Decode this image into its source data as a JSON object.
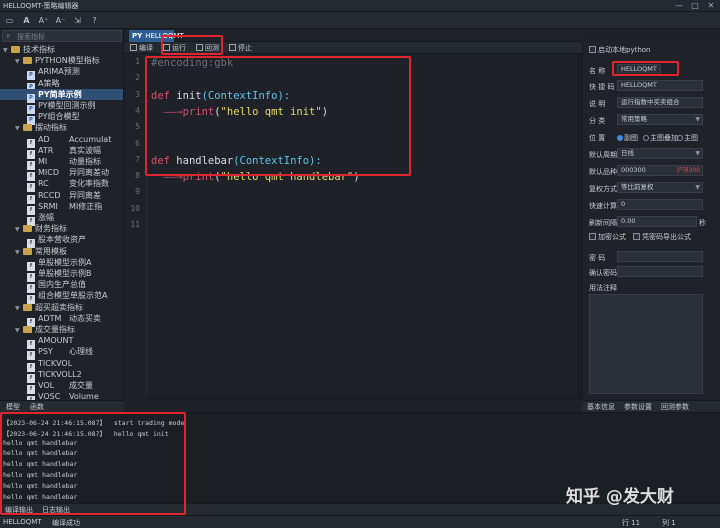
{
  "window": {
    "title": "HELLOQMT-策略编辑器",
    "min": "—",
    "max": "□",
    "close": "✕"
  },
  "toolbar": {
    "icons": [
      "new-icon",
      "open-icon",
      "font-bigger-icon",
      "font-smaller-icon",
      "save-icon",
      "help-icon"
    ],
    "glyphs": [
      "A",
      "A",
      "A",
      "A",
      "⇲",
      "?"
    ]
  },
  "search": {
    "placeholder": "搜索指标",
    "icon": "⌕"
  },
  "tree": [
    {
      "label": "技术指标",
      "level": 0,
      "type": "folder",
      "expanded": true
    },
    {
      "label": "PYTHON模型指标",
      "level": 1,
      "type": "folder",
      "expanded": true
    },
    {
      "label": "ARIMA预测",
      "level": 2,
      "type": "py"
    },
    {
      "label": "A策略",
      "level": 2,
      "type": "py"
    },
    {
      "label": "PY简单示例",
      "level": 2,
      "type": "py",
      "selected": true
    },
    {
      "label": "PY模型回测示例",
      "level": 2,
      "type": "py"
    },
    {
      "label": "PY组合模型",
      "level": 2,
      "type": "py"
    },
    {
      "label": "摆动指标",
      "level": 1,
      "type": "folder",
      "expanded": true
    },
    {
      "label": "AD",
      "sub": "Accumulat",
      "level": 2,
      "type": "file"
    },
    {
      "label": "ATR",
      "sub": "真实波幅",
      "level": 2,
      "type": "file"
    },
    {
      "label": "MI",
      "sub": "动量指标",
      "level": 2,
      "type": "file"
    },
    {
      "label": "MICD",
      "sub": "异同离差动",
      "level": 2,
      "type": "file"
    },
    {
      "label": "RC",
      "sub": "变化率指数",
      "level": 2,
      "type": "file"
    },
    {
      "label": "RCCD",
      "sub": "异同离差",
      "level": 2,
      "type": "file"
    },
    {
      "label": "SRMI",
      "sub": "MI修正指",
      "level": 2,
      "type": "file"
    },
    {
      "label": "涨幅",
      "level": 2,
      "type": "file"
    },
    {
      "label": "财务指标",
      "level": 1,
      "type": "folder",
      "expanded": true
    },
    {
      "label": "股本营收资产",
      "level": 2,
      "type": "file"
    },
    {
      "label": "常用模板",
      "level": 1,
      "type": "folder",
      "expanded": true
    },
    {
      "label": "单股模型示例A",
      "level": 2,
      "type": "file"
    },
    {
      "label": "单股模型示例B",
      "level": 2,
      "type": "file"
    },
    {
      "label": "国内生产总值",
      "level": 2,
      "type": "file"
    },
    {
      "label": "组合模型单股示范A",
      "level": 2,
      "type": "file"
    },
    {
      "label": "超买超卖指标",
      "level": 1,
      "type": "folder",
      "expanded": true
    },
    {
      "label": "ADTM",
      "sub": "动态买卖",
      "level": 2,
      "type": "file"
    },
    {
      "label": "成交量指标",
      "level": 1,
      "type": "folder",
      "expanded": true
    },
    {
      "label": "AMOUNT",
      "level": 2,
      "type": "file"
    },
    {
      "label": "PSY",
      "sub": "心理线",
      "level": 2,
      "type": "file"
    },
    {
      "label": "TICKVOL",
      "level": 2,
      "type": "file"
    },
    {
      "label": "TICKVOLL2",
      "level": 2,
      "type": "file"
    },
    {
      "label": "VOL",
      "sub": "成交量",
      "level": 2,
      "type": "file"
    },
    {
      "label": "VOSC",
      "sub": "Volume",
      "level": 2,
      "type": "file"
    }
  ],
  "left_tabs": [
    "模型",
    "函数"
  ],
  "editor": {
    "tab": "HELLOQMT",
    "tab_icon": "PY",
    "toolbar": {
      "compile": "编译",
      "run": "运行",
      "backtest": "回测",
      "stop": "停止"
    },
    "line_numbers": [
      "1",
      "2",
      "3",
      "4",
      "5",
      "6",
      "7",
      "8",
      "9",
      "10",
      "11"
    ],
    "lines": [
      [
        {
          "t": "#encoding:gbk",
          "c": "cm"
        }
      ],
      [],
      [
        {
          "t": "def ",
          "c": "kw"
        },
        {
          "t": "init",
          "c": "wh"
        },
        {
          "t": "(ContextInfo):",
          "c": "fn"
        }
      ],
      [
        {
          "t": "  ——→",
          "c": "arrow"
        },
        {
          "t": "print",
          "c": "kw"
        },
        {
          "t": "(",
          "c": "wh"
        },
        {
          "t": "\"hello qmt init\"",
          "c": "st"
        },
        {
          "t": ")",
          "c": "wh"
        }
      ],
      [],
      [],
      [
        {
          "t": "def ",
          "c": "kw"
        },
        {
          "t": "handlebar",
          "c": "wh"
        },
        {
          "t": "(ContextInfo):",
          "c": "fn"
        }
      ],
      [
        {
          "t": "  ——→",
          "c": "arrow"
        },
        {
          "t": "print",
          "c": "kw"
        },
        {
          "t": "(",
          "c": "wh"
        },
        {
          "t": "\"hello qmt handlebar\"",
          "c": "st"
        },
        {
          "t": ")",
          "c": "wh"
        }
      ],
      [],
      [],
      []
    ]
  },
  "props": {
    "local_python": "启动本地python",
    "name_label": "名  称",
    "name_value": "HELLOQMT",
    "abbr_label": "快 捷 码",
    "abbr_value": "HELLOQMT",
    "desc_label": "说  明",
    "desc_value": "运行指数中买卖组合",
    "cat_label": "分  类",
    "cat_value": "常用策略",
    "pos_label": "位  置",
    "pos_opt1": "副图",
    "pos_opt2": "主图叠加",
    "pos_opt3": "主图",
    "period_label": "默认周期",
    "period_value": "日线",
    "stock_label": "默认品种",
    "stock_value": "000300",
    "stock_tag": "沪深300",
    "rights_label": "复权方式",
    "rights_value": "等比前复权",
    "fast_label": "快速计算",
    "fast_value": "0",
    "refresh_label": "刷新间隔",
    "refresh_value": "0.00",
    "refresh_unit": "秒",
    "encrypt_label": "加密公式",
    "export_label": "凭密码导出公式",
    "pwd_label": "密  码",
    "confirm_label": "确认密码",
    "note_label": "用法注释"
  },
  "right_tabs": [
    "基本信息",
    "参数设置",
    "回测参数"
  ],
  "output": {
    "lines": [
      "【2023-06-24 21:46:15.087】  start trading mode",
      "【2023-06-24 21:46:15.087】  hello qmt init",
      "hello qmt handlebar",
      "hello qmt handlebar",
      "hello qmt handlebar",
      "hello qmt handlebar",
      "hello qmt handlebar",
      "hello qmt handlebar"
    ]
  },
  "bottom_tabs": [
    "编译输出",
    "日志输出"
  ],
  "status": {
    "left_tag": "HELLOQMT",
    "left_text": "编译成功",
    "mid": "",
    "row": "行 11",
    "col": "列 1"
  },
  "watermark": "知乎 @发大财"
}
